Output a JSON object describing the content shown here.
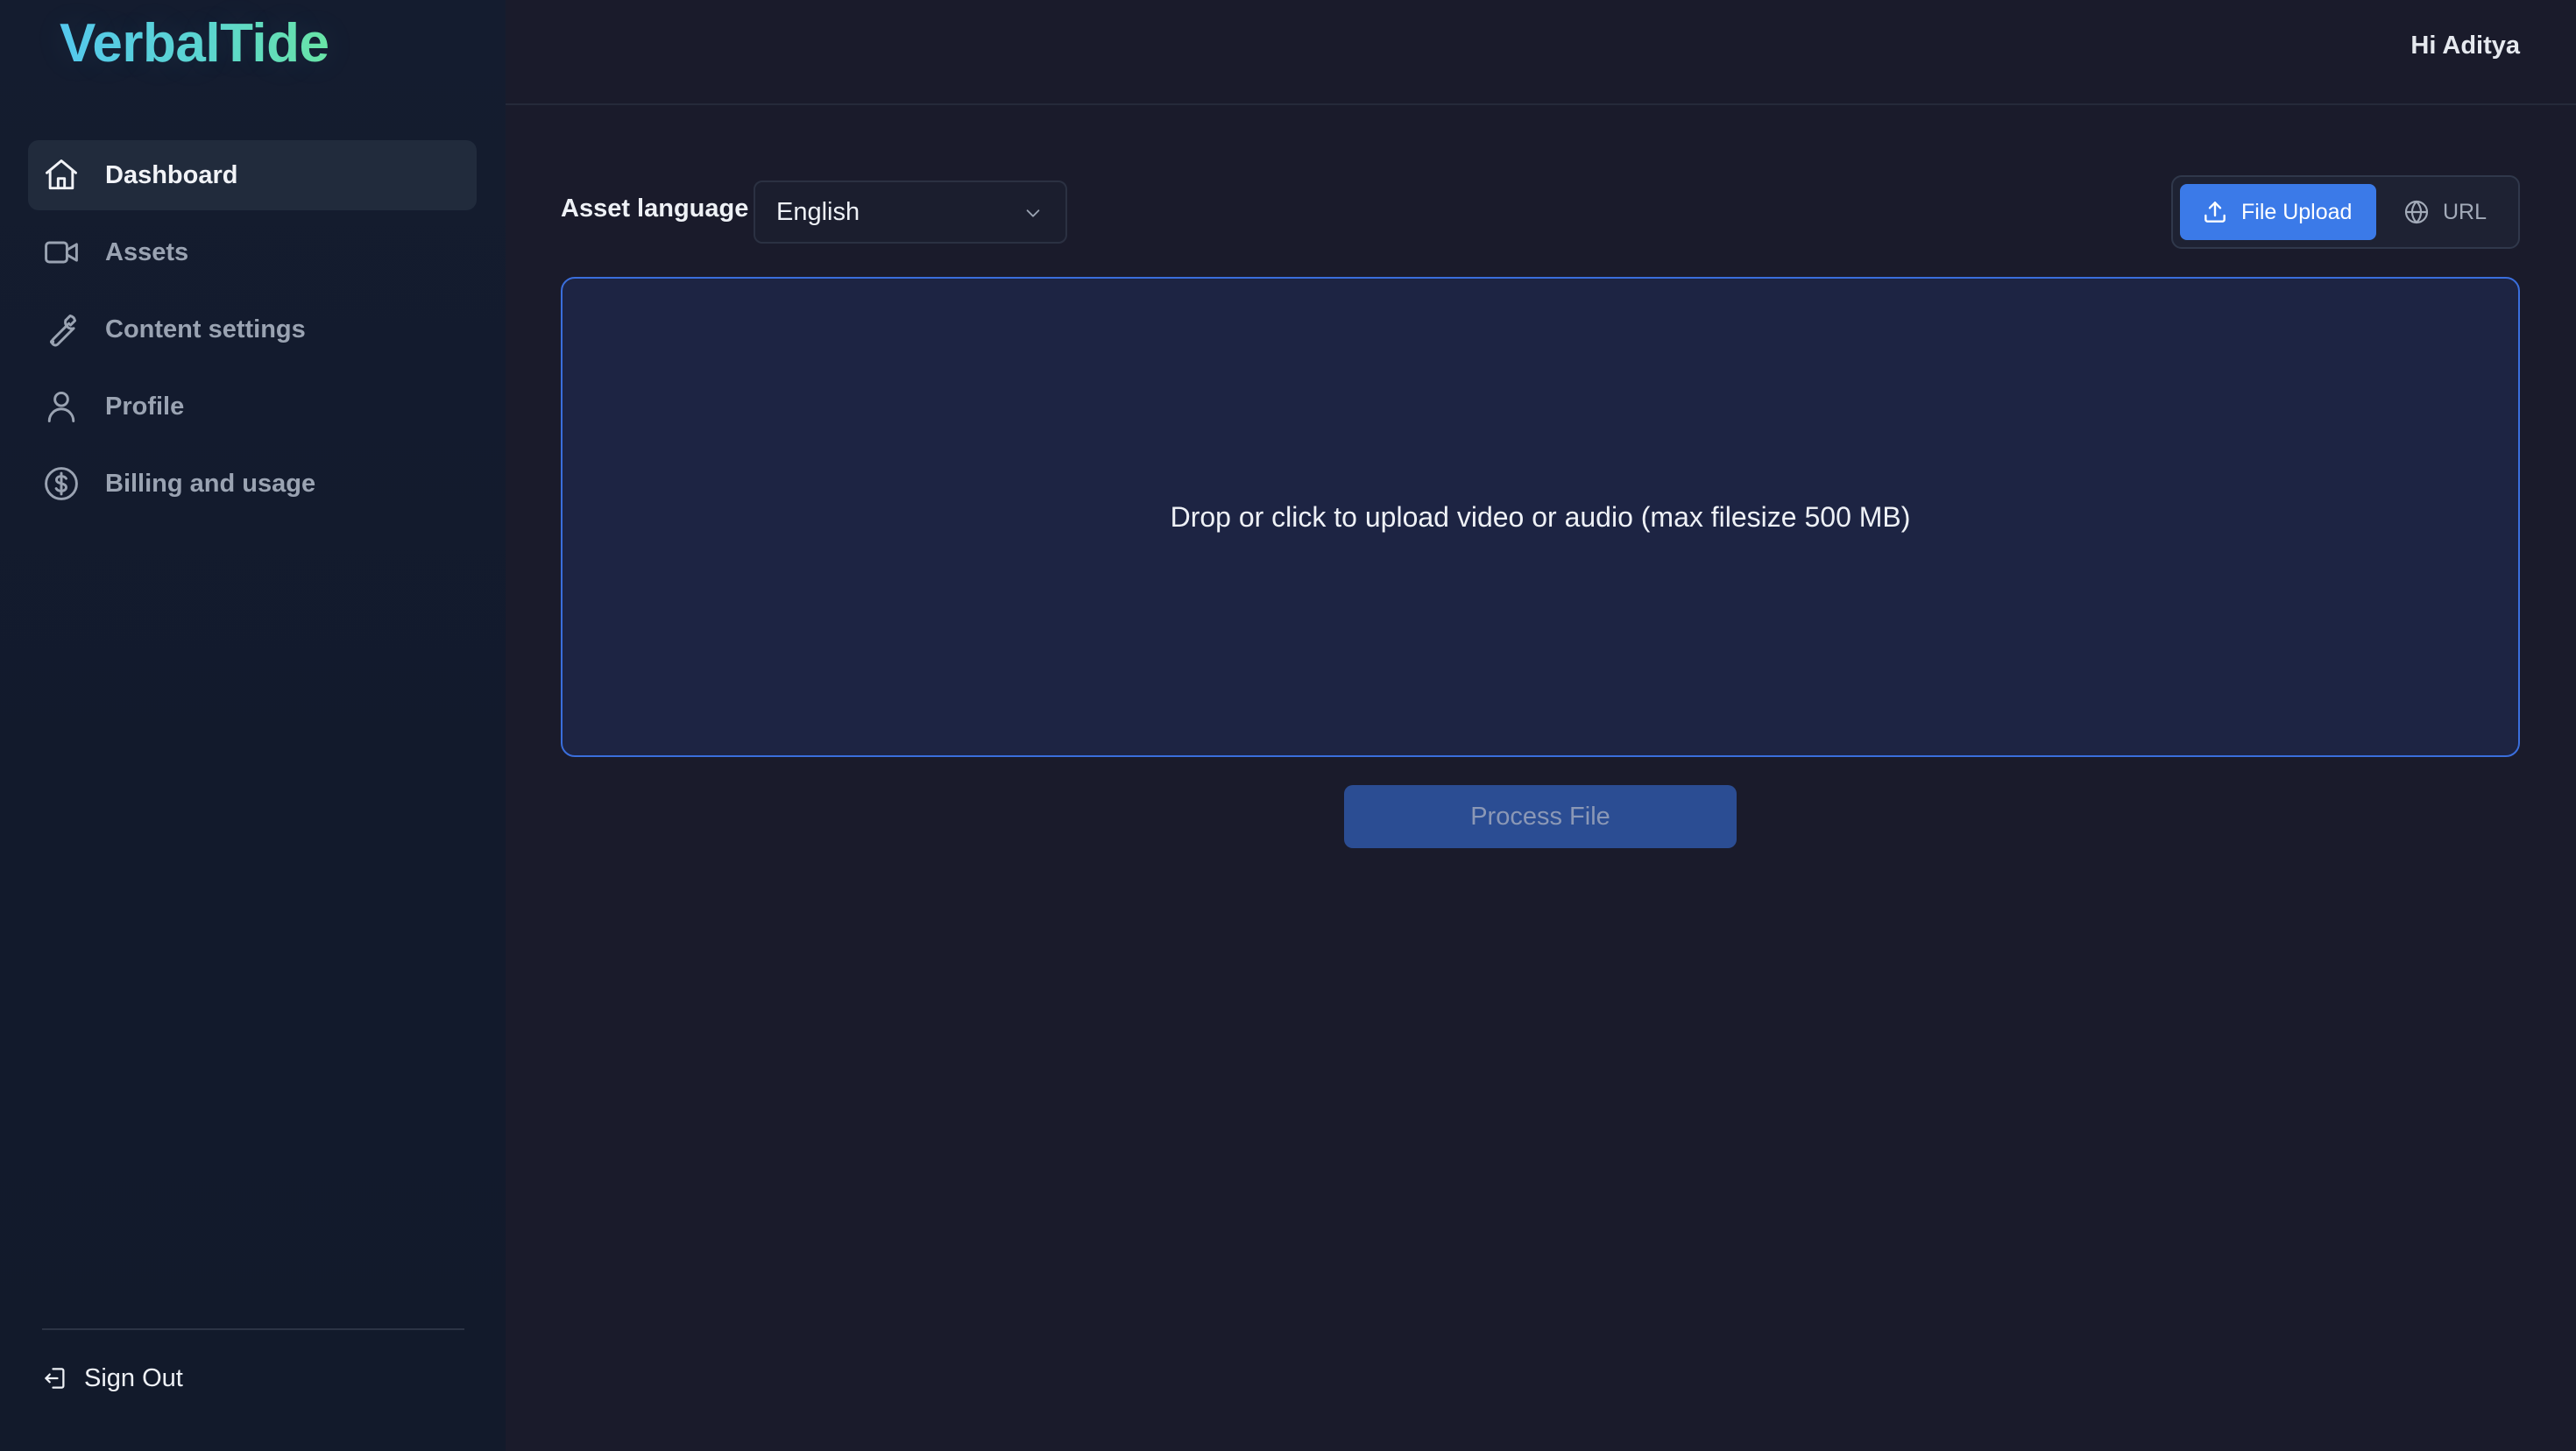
{
  "app": {
    "logo": "VerbalTide"
  },
  "sidebar": {
    "items": [
      {
        "label": "Dashboard",
        "icon": "home-icon",
        "active": true
      },
      {
        "label": "Assets",
        "icon": "video-camera-icon",
        "active": false
      },
      {
        "label": "Content settings",
        "icon": "wrench-icon",
        "active": false
      },
      {
        "label": "Profile",
        "icon": "user-icon",
        "active": false
      },
      {
        "label": "Billing and usage",
        "icon": "dollar-circle-icon",
        "active": false
      }
    ],
    "sign_out": {
      "label": "Sign Out",
      "icon": "sign-out-icon"
    }
  },
  "header": {
    "greeting": "Hi Aditya"
  },
  "main": {
    "language": {
      "label": "Asset language",
      "selected": "English"
    },
    "source_toggle": {
      "file_upload": "File Upload",
      "url": "URL",
      "selected": "File Upload"
    },
    "dropzone": {
      "text": "Drop or click to upload video or audio (max filesize 500 MB)"
    },
    "process_button": "Process File"
  },
  "colors": {
    "background": "#1a1b2b",
    "sidebar": "#131b2e",
    "accent": "#3b7ae8",
    "dropzone_fill": "#1d2443",
    "dropzone_border": "#3a6edc",
    "process_disabled": "#2b4d93"
  }
}
